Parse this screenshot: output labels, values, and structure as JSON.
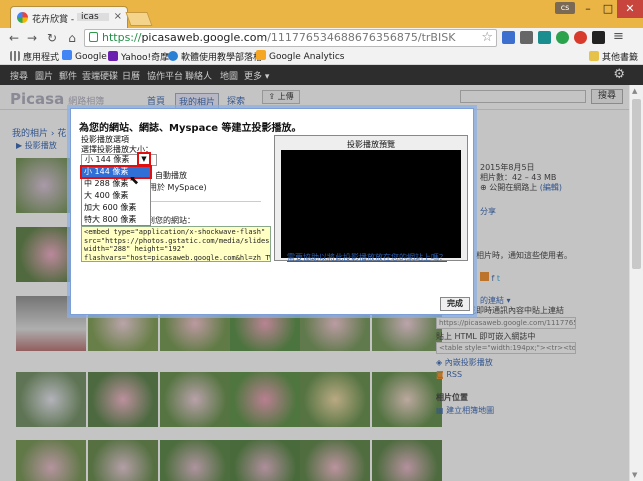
{
  "browser": {
    "tab_title": "花卉欣賞 -",
    "tab_title_suffix": "icas",
    "url_scheme": "https://",
    "url_host": "picasaweb.google.com",
    "url_path": "/111776534688676356875/trBISK",
    "user_badge": "cs"
  },
  "bookmarks": {
    "apps": "應用程式",
    "google": "Google",
    "yahoo": "Yahoo!奇摩",
    "software": "軟體使用教學部落格",
    "analytics": "Google Analytics",
    "other": "其他書籤"
  },
  "gbar": {
    "items": [
      "搜尋",
      "圖片",
      "郵件",
      "雲端硬碟",
      "日曆",
      "協作平台",
      "聯絡人",
      "地圖",
      "更多 ▾"
    ]
  },
  "picasa": {
    "logo": "Picasa",
    "logo_sub": "網路相簿",
    "tabs": [
      "首頁",
      "我的相片",
      "探索"
    ],
    "upload": "上傳",
    "search_button": "搜尋",
    "breadcrumb": "我的相片 › 花",
    "slideshow": "投影播放"
  },
  "right_column": {
    "date": "2015年8月5日",
    "count": "相片數：42 – 43 MB",
    "visibility": "公開在網路上",
    "edit": "(編輯)",
    "share_link": "分享",
    "notify_text": "相片時，通知這些使用者。",
    "link_header": "的連結 ▾",
    "link_desc": "電子郵件或即時通訊內容中貼上連結",
    "link_value": "https://picasaweb.google.com/11177653",
    "embed_label": "貼上 HTML 即可嵌入網誌中",
    "embed_value": "<table style=\"width:194px;\"><tr><td align",
    "embed_slideshow": "內嵌投影播放",
    "rss": "RSS",
    "location_header": "相片位置",
    "create_map": "建立相簿地圖"
  },
  "dialog": {
    "title": "為您的網站、網誌、Myspace 等建立投影播放。",
    "options_title": "投影播放選項",
    "size_label": "選擇投影播放大小：",
    "size_selected": "小 144 像素",
    "size_options": [
      "小 144 像素",
      "中 288 像素",
      "大 400 像素",
      "加大 600 像素",
      "特大 800 像素"
    ],
    "autoplay_label": "自動播放",
    "myspace_label": "用於 MySpace)",
    "embed_label": "到您的網站：",
    "embed_code": "<embed type=\"application/x-shockwave-flash\"\nsrc=\"https://photos.gstatic.com/media/slideshow.swf\"\nwidth=\"288\" height=\"192\"\nflashvars=\"host=picasaweb.google.com&hl=zh_TW&fe",
    "preview_title": "投影播放預覽",
    "help_link": "需要協助以將此投影播放放在您的網站上嗎？",
    "done_button": "完成"
  },
  "colors": {
    "chrome_frame": "#eab545",
    "highlight": "#2f6fd6",
    "annotation_red": "#e01010",
    "link": "#2a5db0"
  }
}
